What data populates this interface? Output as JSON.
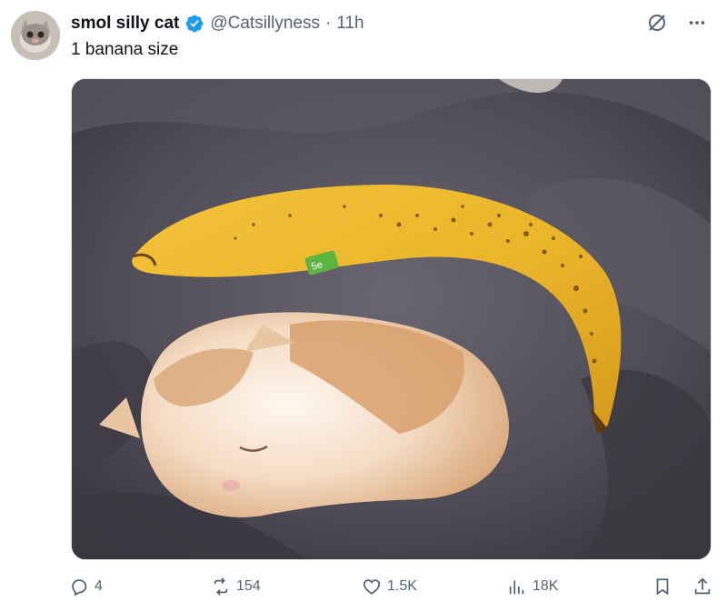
{
  "tweet": {
    "display_name": "smol silly cat",
    "handle": "@Catsillyness",
    "separator": "·",
    "time": "11h",
    "text": "1 banana size"
  },
  "media": {
    "banana_sticker_text": "5e"
  },
  "icons": {
    "verified": "verified-badge-icon",
    "grok": "grok-icon",
    "more": "more-icon",
    "reply": "reply-icon",
    "retweet": "retweet-icon",
    "like": "heart-icon",
    "views": "views-icon",
    "bookmark": "bookmark-icon",
    "share": "share-icon"
  },
  "stats": {
    "replies": "4",
    "retweets": "154",
    "likes": "1.5K",
    "views": "18K"
  },
  "colors": {
    "verified": "#1d9bf0",
    "text": "#0f1419",
    "muted": "#536471"
  }
}
